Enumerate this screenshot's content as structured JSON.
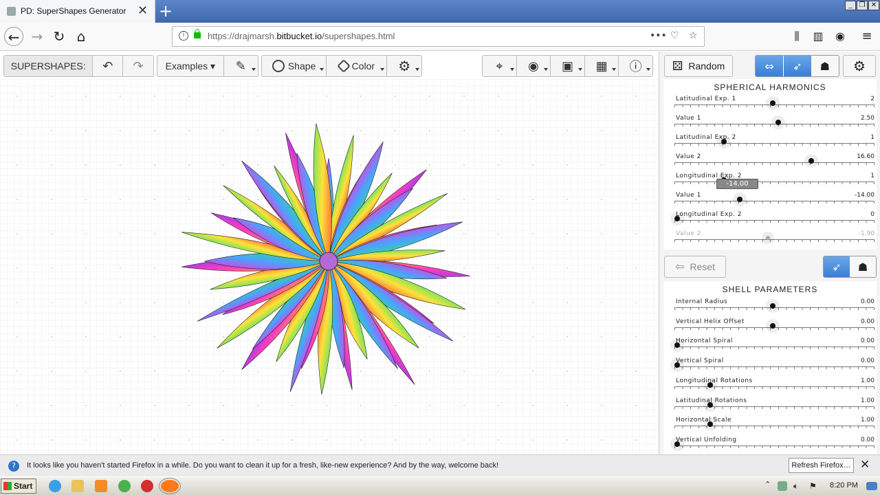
{
  "browser": {
    "tab_title": "PD: SuperShapes Generator",
    "url_scheme": "https://drajmarsh.",
    "url_domain": "bitbucket.io",
    "url_path": "/supershapes.html",
    "page_actions": "•••"
  },
  "toolbar": {
    "app_label": "SUPERSHAPES:",
    "examples": "Examples",
    "shape": "Shape",
    "color": "Color"
  },
  "right_panel": {
    "random_label": "Random",
    "spherical_title": "SPHERICAL HARMONICS",
    "spherical": [
      {
        "label": "Latitudinal Exp. 1",
        "value": "2",
        "pos": 0.49
      },
      {
        "label": "Value 1",
        "value": "2.50",
        "pos": 0.52
      },
      {
        "label": "Latitudinal Exp. 2",
        "value": "1",
        "pos": 0.24
      },
      {
        "label": "Value 2",
        "value": "16.60",
        "pos": 0.69
      },
      {
        "label": "Longitudinal Exp. 2",
        "value": "1",
        "pos": 0.24
      },
      {
        "label": "Value 1",
        "value": "-14.00",
        "pos": 0.32
      },
      {
        "label": "Longitudinal Exp. 2",
        "value": "0",
        "pos": 0.0
      },
      {
        "label": "Value 2",
        "value": "-1.90",
        "pos": 0.47
      }
    ],
    "tooltip_value": "-14.00",
    "reset_label": "Reset",
    "shell_title": "SHELL PARAMETERS",
    "shell": [
      {
        "label": "Internal Radius",
        "value": "0.00",
        "pos": 0.49
      },
      {
        "label": "Vertical Helix Offset",
        "value": "0.00",
        "pos": 0.49
      },
      {
        "label": "Horizontal Spiral",
        "value": "0.00",
        "pos": 0.0
      },
      {
        "label": "Vertical Spiral",
        "value": "0.00",
        "pos": 0.0
      },
      {
        "label": "Longitudinal Rotations",
        "value": "1.00",
        "pos": 0.17
      },
      {
        "label": "Latitudinal Rotations",
        "value": "1.00",
        "pos": 0.17
      },
      {
        "label": "Horizontal Scale",
        "value": "1.00",
        "pos": 0.17
      },
      {
        "label": "Vertical Unfolding",
        "value": "0.00",
        "pos": 0.0
      }
    ]
  },
  "notification": {
    "message": "It looks like you haven't started Firefox in a while. Do you want to clean it up for a fresh, like-new experience? And by the way, welcome back!",
    "button": "Refresh Firefox…"
  },
  "taskbar": {
    "start": "Start",
    "clock": "8:20 PM"
  },
  "colors": {
    "accent": "#3b7fd4",
    "titlebar": "#3f67ad"
  }
}
